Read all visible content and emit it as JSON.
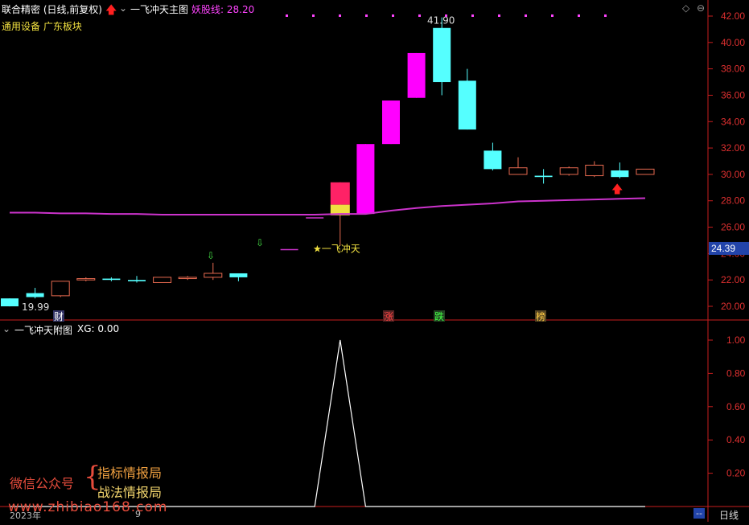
{
  "header": {
    "main_name": "联合精密 (日线,前复权)",
    "indicator_name": "一飞冲天主图",
    "yao_label": "妖股线: 28.20",
    "sector": "通用设备 广东板块",
    "sub_name": "一飞冲天附图",
    "sub_value": "XG: 0.00"
  },
  "footer": {
    "year_label": "2023年",
    "month_label": "9",
    "period_label": "日线",
    "dash_label": "--"
  },
  "watermark": {
    "line1": "微信公众号",
    "line2": "指标情报局",
    "line3": "战法情报局",
    "url": "www.zhibiao168.com",
    "brace": "{"
  },
  "colors": {
    "up": "#ff00ff",
    "down": "#55ffff",
    "doji": "#e86a50",
    "ma": "#cc33cc",
    "axis": "#c81e1e",
    "price_box": "#2244aa",
    "yellow": "#f0e040",
    "crimson": "#ff2266"
  },
  "chart_data": [
    {
      "type": "candlestick",
      "title": "一飞冲天主图",
      "ylim": [
        19.2,
        42.8
      ],
      "yticks": [
        20.0,
        22.0,
        24.0,
        26.0,
        28.0,
        30.0,
        32.0,
        34.0,
        36.0,
        38.0,
        40.0,
        42.0
      ],
      "current_price": "24.39",
      "candles": [
        {
          "o": 20.0,
          "h": 20.6,
          "l": 19.99,
          "c": 20.6,
          "color": "down"
        },
        {
          "o": 20.7,
          "h": 21.4,
          "l": 20.6,
          "c": 21.0,
          "color": "down"
        },
        {
          "o": 21.9,
          "h": 21.9,
          "l": 20.7,
          "c": 20.8,
          "color": "doji"
        },
        {
          "o": 22.0,
          "h": 22.2,
          "l": 21.9,
          "c": 22.1,
          "color": "doji"
        },
        {
          "o": 22.1,
          "h": 22.2,
          "l": 21.9,
          "c": 22.0,
          "color": "down"
        },
        {
          "o": 22.0,
          "h": 22.3,
          "l": 21.8,
          "c": 21.9,
          "color": "down"
        },
        {
          "o": 22.2,
          "h": 22.2,
          "l": 21.8,
          "c": 21.8,
          "color": "doji"
        },
        {
          "o": 22.1,
          "h": 22.3,
          "l": 22.0,
          "c": 22.2,
          "color": "doji"
        },
        {
          "o": 22.5,
          "h": 23.3,
          "l": 22.0,
          "c": 22.2,
          "color": "doji"
        },
        {
          "o": 22.5,
          "h": 22.5,
          "l": 21.9,
          "c": 22.2,
          "color": "down"
        },
        {
          "o": null
        },
        {
          "o": 24.3,
          "h": 24.3,
          "l": 24.3,
          "c": 24.3,
          "color": "ma"
        },
        {
          "o": 26.7,
          "h": 26.7,
          "l": 26.7,
          "c": 26.7,
          "color": "ma"
        },
        {
          "o": 26.9,
          "h": 29.4,
          "l": 24.6,
          "c": 29.4,
          "color": "special"
        },
        {
          "o": 27.0,
          "h": 32.3,
          "l": 27.0,
          "c": 32.3,
          "color": "up"
        },
        {
          "o": 32.3,
          "h": 35.6,
          "l": 32.3,
          "c": 35.6,
          "color": "up"
        },
        {
          "o": 35.8,
          "h": 39.2,
          "l": 35.8,
          "c": 39.2,
          "color": "up"
        },
        {
          "o": 41.1,
          "h": 41.9,
          "l": 36.0,
          "c": 37.0,
          "color": "down"
        },
        {
          "o": 37.1,
          "h": 38.0,
          "l": 33.4,
          "c": 33.4,
          "color": "down"
        },
        {
          "o": 31.8,
          "h": 32.4,
          "l": 30.3,
          "c": 30.4,
          "color": "down"
        },
        {
          "o": 30.5,
          "h": 31.3,
          "l": 30.0,
          "c": 30.0,
          "color": "doji"
        },
        {
          "o": 29.9,
          "h": 30.4,
          "l": 29.3,
          "c": 29.8,
          "color": "down"
        },
        {
          "o": 30.5,
          "h": 30.6,
          "l": 29.9,
          "c": 30.0,
          "color": "doji"
        },
        {
          "o": 30.7,
          "h": 31.0,
          "l": 29.8,
          "c": 29.9,
          "color": "doji"
        },
        {
          "o": 30.3,
          "h": 30.9,
          "l": 29.7,
          "c": 29.8,
          "color": "down"
        },
        {
          "o": 30.4,
          "h": 30.4,
          "l": 30.0,
          "c": 30.0,
          "color": "doji"
        }
      ],
      "yao_line": [
        27.1,
        27.1,
        27.05,
        27.05,
        27.0,
        27.0,
        26.95,
        26.95,
        26.95,
        26.95,
        26.95,
        26.95,
        26.95,
        27.0,
        27.0,
        27.25,
        27.45,
        27.6,
        27.7,
        27.8,
        27.95,
        28.0,
        28.05,
        28.1,
        28.15,
        28.2
      ],
      "annotations": {
        "high_label": "41.90",
        "low_label": "19.99",
        "signal_text": "★一飞冲天",
        "cai_label": "财",
        "zhang_label": "涨",
        "die_label": "跌",
        "bang_label": "榜"
      }
    },
    {
      "type": "line",
      "title": "一飞冲天附图",
      "ylim": [
        0.0,
        1.0
      ],
      "yticks": [
        0.2,
        0.4,
        0.6,
        0.8,
        1.0
      ],
      "series": [
        {
          "name": "XG",
          "values": [
            0,
            0,
            0,
            0,
            0,
            0,
            0,
            0,
            0,
            0,
            0,
            0,
            0,
            1,
            0,
            0,
            0,
            0,
            0,
            0,
            0,
            0,
            0,
            0,
            0,
            0
          ]
        }
      ]
    }
  ]
}
